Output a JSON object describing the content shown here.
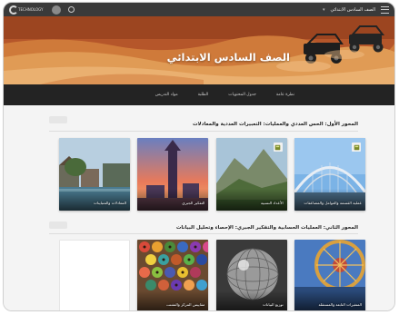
{
  "topbar": {
    "course_title": "الصف السادس الابتدائي",
    "section_link": "",
    "user_name": "",
    "logo_text": "TECHNOLOGY"
  },
  "hero": {
    "title": "الصف السادس الابتدائي"
  },
  "nav": {
    "tabs": [
      {
        "label": "نظرة عامة"
      },
      {
        "label": "جدول المحتويات"
      },
      {
        "label": "الطلبة"
      },
      {
        "label": "مواد التدريس"
      }
    ]
  },
  "sections": [
    {
      "title": "المحور الأول: الحس العددي والعمليات: التعبيرات العددية والمعادلات",
      "cards": [
        {
          "title": "عملية القسمة والعوامل والمضاعفات",
          "badge": true
        },
        {
          "title": "الأعداد النسبية",
          "badge": true
        },
        {
          "title": "التفكير الجبري",
          "badge": false
        },
        {
          "title": "المعادلات والمتباينات",
          "badge": false
        }
      ]
    },
    {
      "title": "المحور الثاني: العمليات الحسابية والتفكير الجبري: الإحصاء وتحليل البيانات",
      "cards": [
        {
          "title": "المتغيرات التابعة والمستقلة",
          "badge": false
        },
        {
          "title": "توزيع البيانات",
          "badge": false
        },
        {
          "title": "مقاييس المركز والتشتت",
          "badge": false
        },
        {
          "title": "",
          "badge": false
        }
      ]
    }
  ],
  "colors": {
    "topbar": "#3a3a3a",
    "nav": "#232323",
    "badge_icon": "#7a8a2a"
  },
  "icons": [
    "menu-icon",
    "search-icon",
    "user-avatar",
    "logo-mark",
    "calculator-icon"
  ]
}
